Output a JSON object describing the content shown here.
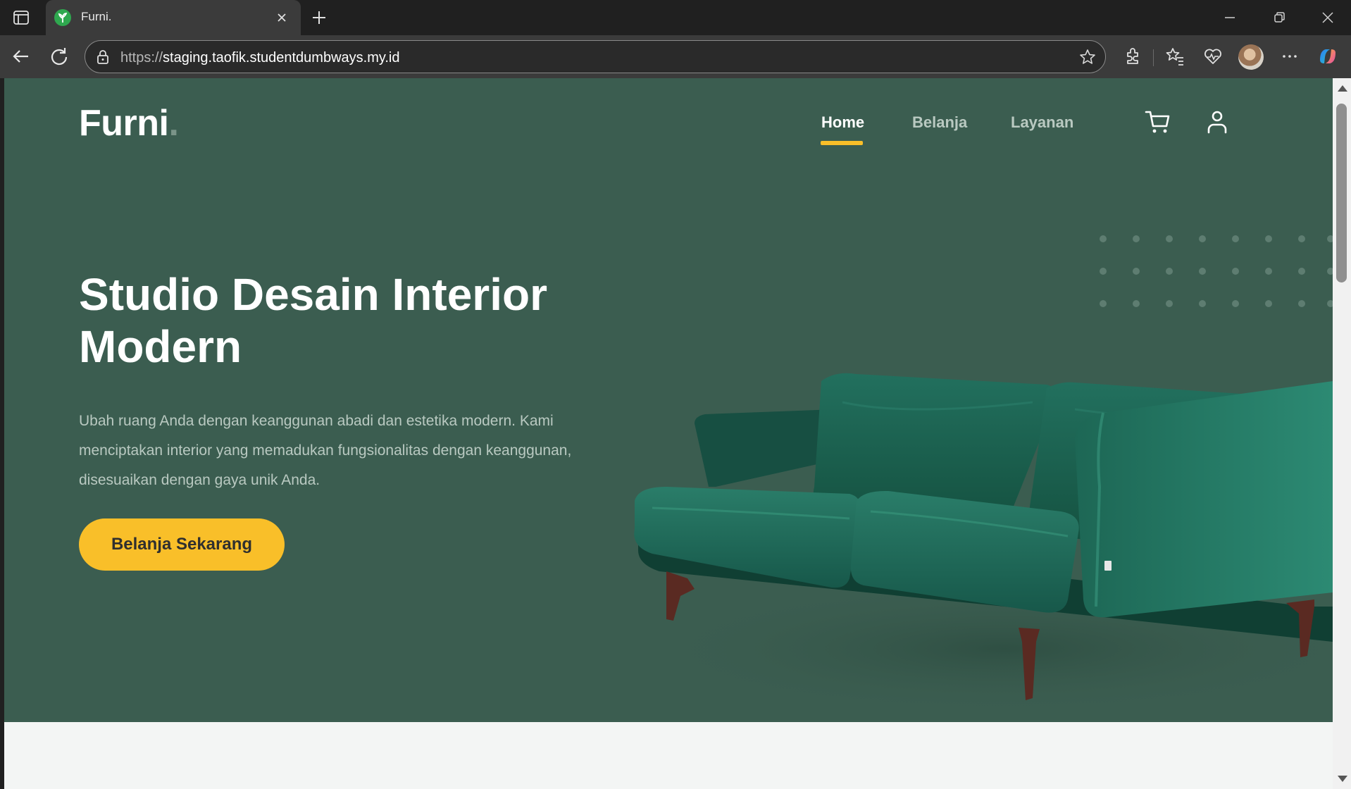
{
  "browser": {
    "tab": {
      "title": "Furni.",
      "favicon": "leaf-icon"
    },
    "address": {
      "protocol": "https://",
      "host": "staging.taofik.studentdumbways.my.id"
    },
    "toolbar_icons": [
      "back-icon",
      "reload-icon",
      "extensions-icon",
      "favorites-icon",
      "health-icon",
      "profile-avatar",
      "more-icon",
      "copilot-icon"
    ]
  },
  "site": {
    "logo": {
      "text": "Furni",
      "dot": "."
    },
    "nav": [
      {
        "label": "Home",
        "active": true
      },
      {
        "label": "Belanja",
        "active": false
      },
      {
        "label": "Layanan",
        "active": false
      }
    ],
    "header_icons": [
      "cart-icon",
      "user-icon"
    ],
    "hero": {
      "title": "Studio Desain Interior Modern",
      "text": "Ubah ruang Anda dengan keanggunan abadi dan estetika modern. Kami menciptakan interior yang memadukan fungsionalitas dengan keanggunan, disesuaikan dengan gaya unik Anda.",
      "cta": "Belanja Sekarang",
      "image": "green-velvet-sofa"
    }
  },
  "colors": {
    "hero_bg": "#3b5d50",
    "accent": "#f9bf29",
    "muted_text": "#b9c9c1",
    "page_bg": "#f3f5f4"
  }
}
